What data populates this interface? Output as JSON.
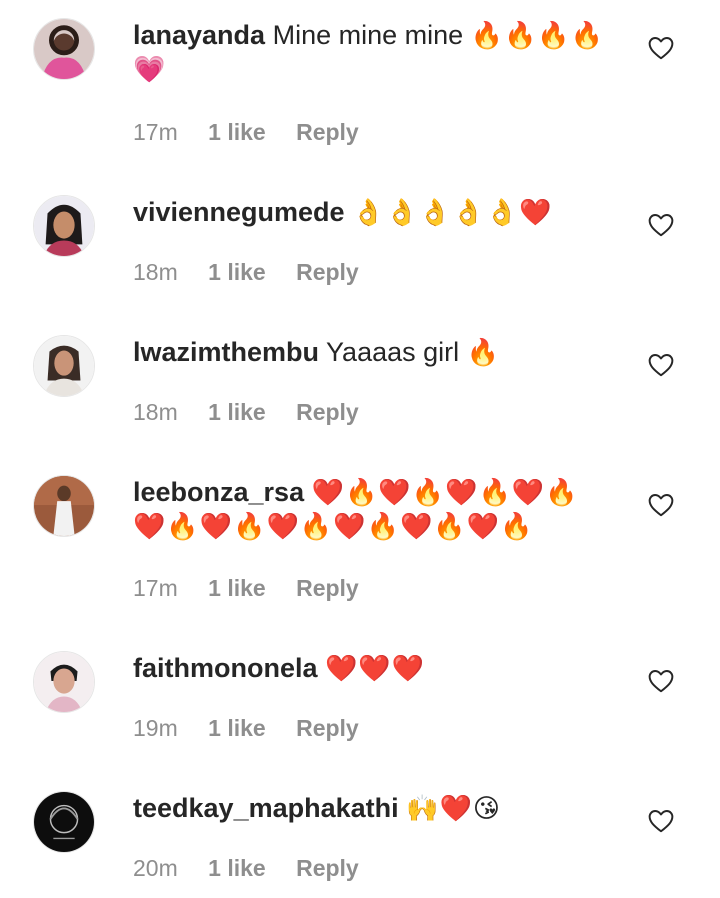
{
  "comments": [
    {
      "username": "lanayanda",
      "message": "Mine mine mine",
      "emojis": "🔥🔥🔥🔥",
      "emojis_line2": "💗",
      "time": "17m",
      "likes": "1 like",
      "reply": "Reply"
    },
    {
      "username": "viviennegumede",
      "message": "",
      "emojis": "👌👌👌👌👌❤️",
      "emojis_line2": "",
      "time": "18m",
      "likes": "1 like",
      "reply": "Reply"
    },
    {
      "username": "lwazimthembu",
      "message": "Yaaaas girl",
      "emojis": "🔥",
      "emojis_line2": "",
      "time": "18m",
      "likes": "1 like",
      "reply": "Reply"
    },
    {
      "username": "leebonza_rsa",
      "message": "",
      "emojis": "❤️🔥❤️🔥❤️🔥❤️🔥",
      "emojis_line2": "❤️🔥❤️🔥❤️🔥❤️🔥❤️🔥❤️🔥",
      "time": "17m",
      "likes": "1 like",
      "reply": "Reply"
    },
    {
      "username": "faithmononela",
      "message": "",
      "emojis": "❤️❤️❤️",
      "emojis_line2": "",
      "time": "19m",
      "likes": "1 like",
      "reply": "Reply"
    },
    {
      "username": "teedkay_maphakathi",
      "message": "",
      "emojis": "🙌❤️😘",
      "emojis_line2": "",
      "time": "20m",
      "likes": "1 like",
      "reply": "Reply"
    }
  ],
  "icons": {
    "like": "heart-outline-icon"
  },
  "colors": {
    "text": "#262626",
    "meta": "#8e8e8e",
    "background": "#ffffff"
  }
}
